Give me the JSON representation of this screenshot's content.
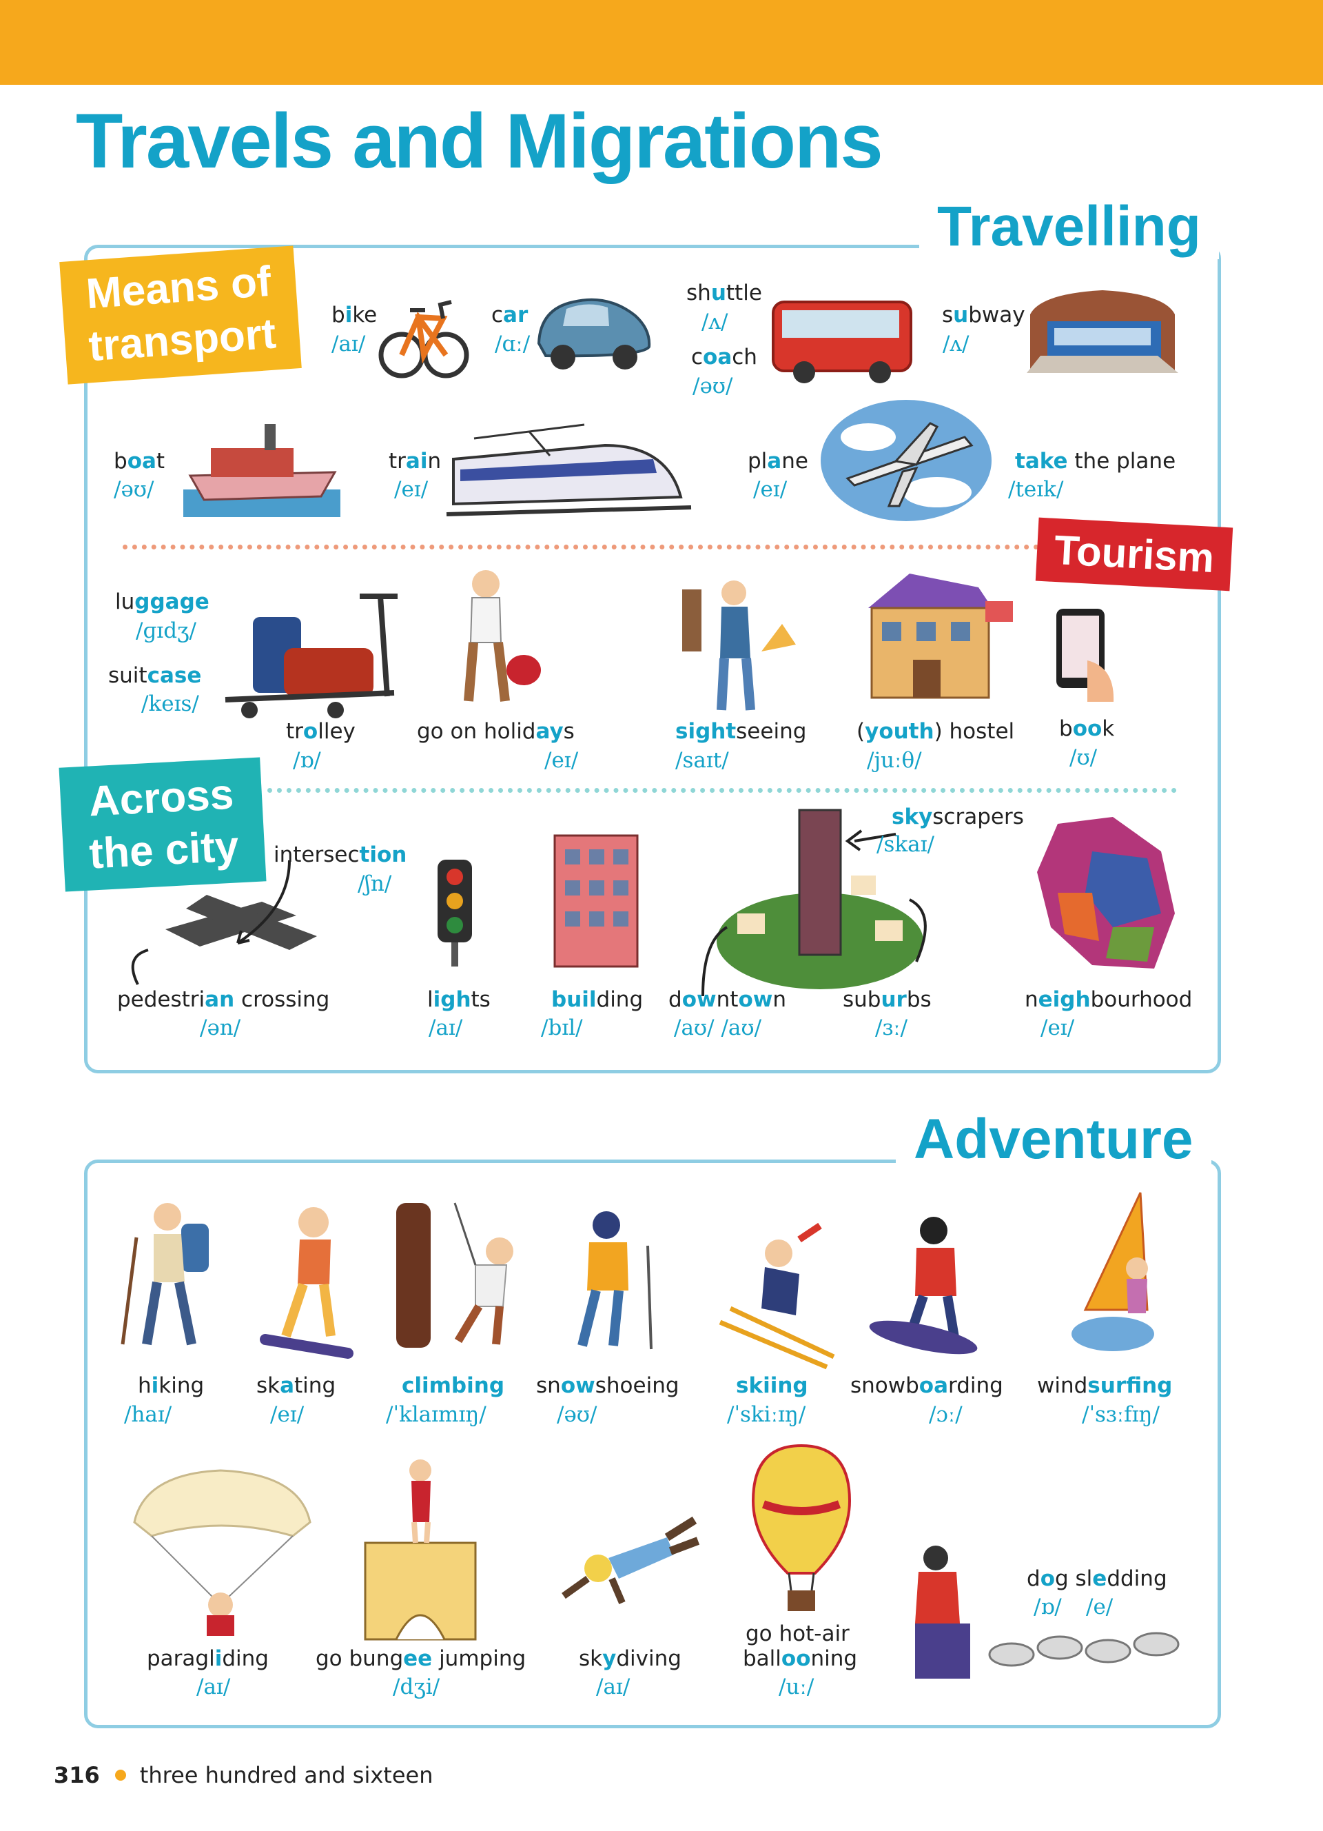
{
  "page_title": "Travels and Migrations",
  "sections": {
    "travelling": "Travelling",
    "adventure": "Adventure"
  },
  "tags": {
    "means_line1": "Means of",
    "means_line2": "transport",
    "tourism": "Tourism",
    "city_line1": "Across",
    "city_line2": "the city"
  },
  "transport": {
    "bike": {
      "pre": "b",
      "hl": "i",
      "post": "ke",
      "ipa": "/aɪ/"
    },
    "car": {
      "pre": "c",
      "hl": "ar",
      "post": "",
      "ipa": "/ɑː/"
    },
    "shuttle": {
      "pre": "sh",
      "hl": "u",
      "post": "ttle",
      "ipa": "/ʌ/"
    },
    "coach": {
      "pre": "c",
      "hl": "oa",
      "post": "ch",
      "ipa": "/əʊ/"
    },
    "subway": {
      "pre": "s",
      "hl": "u",
      "post": "bway",
      "ipa": "/ʌ/"
    },
    "boat": {
      "pre": "b",
      "hl": "oa",
      "post": "t",
      "ipa": "/əʊ/"
    },
    "train": {
      "pre": "tr",
      "hl": "ai",
      "post": "n",
      "ipa": "/eɪ/"
    },
    "plane": {
      "pre": "pl",
      "hl": "a",
      "post": "ne",
      "ipa": "/eɪ/"
    },
    "take_plane": {
      "hl": "take",
      "post": " the plane",
      "ipa": "/teɪk/"
    }
  },
  "tourism": {
    "luggage": {
      "pre": "lu",
      "hl": "ggage",
      "post": "",
      "ipa": "/ɡɪdʒ/"
    },
    "suitcase": {
      "pre": "suit",
      "hl": "case",
      "post": "",
      "ipa": "/keɪs/"
    },
    "trolley": {
      "pre": "tr",
      "hl": "o",
      "post": "lley",
      "ipa": "/ɒ/"
    },
    "holidays": {
      "pre": "go on holid",
      "hl": "ay",
      "post": "s",
      "ipa": "/eɪ/"
    },
    "sightseeing": {
      "pre": "",
      "hl": "sight",
      "post": "seeing",
      "ipa": "/saɪt/"
    },
    "hostel": {
      "pre": "(",
      "hl": "youth",
      "post": ") hostel",
      "ipa": "/juːθ/"
    },
    "book": {
      "pre": "b",
      "hl": "oo",
      "post": "k",
      "ipa": "/ʊ/"
    }
  },
  "city": {
    "intersection": {
      "pre": "intersec",
      "hl": "tion",
      "post": "",
      "ipa": "/ʃn/"
    },
    "skyscrapers": {
      "pre": "",
      "hl": "sky",
      "post": "scrapers",
      "ipa": "/skaɪ/"
    },
    "crossing": {
      "pre": "pedestri",
      "hl": "an",
      "post": " crossing",
      "ipa": "/ən/"
    },
    "lights": {
      "pre": "l",
      "hl": "igh",
      "post": "ts",
      "ipa": "/aɪ/"
    },
    "building": {
      "pre": "",
      "hl": "buil",
      "post": "ding",
      "ipa": "/bɪl/"
    },
    "downtown": {
      "pre": "d",
      "hl1": "ow",
      "mid": "nt",
      "hl2": "ow",
      "post": "n",
      "ipa": "/aʊ/ /aʊ/"
    },
    "suburbs": {
      "pre": "sub",
      "hl": "ur",
      "post": "bs",
      "ipa": "/ɜː/"
    },
    "neighbourhood": {
      "pre": "n",
      "hl": "eigh",
      "post": "bourhood",
      "ipa": "/eɪ/"
    }
  },
  "adventure": {
    "hiking": {
      "pre": "h",
      "hl": "i",
      "post": "king",
      "ipa": "/haɪ/"
    },
    "skating": {
      "pre": "sk",
      "hl": "a",
      "post": "ting",
      "ipa": "/eɪ/"
    },
    "climbing": {
      "pre": "",
      "hl": "climbing",
      "post": "",
      "ipa": "/ˈklaɪmɪŋ/"
    },
    "snowshoeing": {
      "pre": "sn",
      "hl": "ow",
      "post": "shoeing",
      "ipa": "/əʊ/"
    },
    "skiing": {
      "pre": "",
      "hl": "skiing",
      "post": "",
      "ipa": "/ˈskiːɪŋ/"
    },
    "snowboarding": {
      "pre": "snowb",
      "hl": "oa",
      "post": "rding",
      "ipa": "/ɔː/"
    },
    "windsurfing": {
      "pre": "wind",
      "hl": "surfing",
      "post": "",
      "ipa": "/ˈsɜːfɪŋ/"
    },
    "paragliding": {
      "pre": "paragl",
      "hl": "i",
      "post": "ding",
      "ipa": "/aɪ/"
    },
    "bungee": {
      "pre": "go bung",
      "hl": "ee",
      "post": " jumping",
      "ipa": "/dʒi/"
    },
    "skydiving": {
      "pre": "sk",
      "hl": "y",
      "post": "diving",
      "ipa": "/aɪ/"
    },
    "ballooning": {
      "line1": "go hot-air",
      "pre": "ball",
      "hl": "oo",
      "post": "ning",
      "ipa": "/uː/"
    },
    "dogsledding": {
      "pre": "d",
      "hl1": "o",
      "mid": "g sl",
      "hl2": "e",
      "post": "dding",
      "ipa1": "/ɒ/",
      "ipa2": "/e/"
    }
  },
  "footer": {
    "page_number": "316",
    "page_text": "three hundred and sixteen"
  },
  "colors": {
    "accent": "#14A2C8",
    "banner": "#F6A81C",
    "tourism_red": "#D7262C",
    "city_teal": "#20B3B4",
    "panel_border": "#8ECDE3"
  }
}
